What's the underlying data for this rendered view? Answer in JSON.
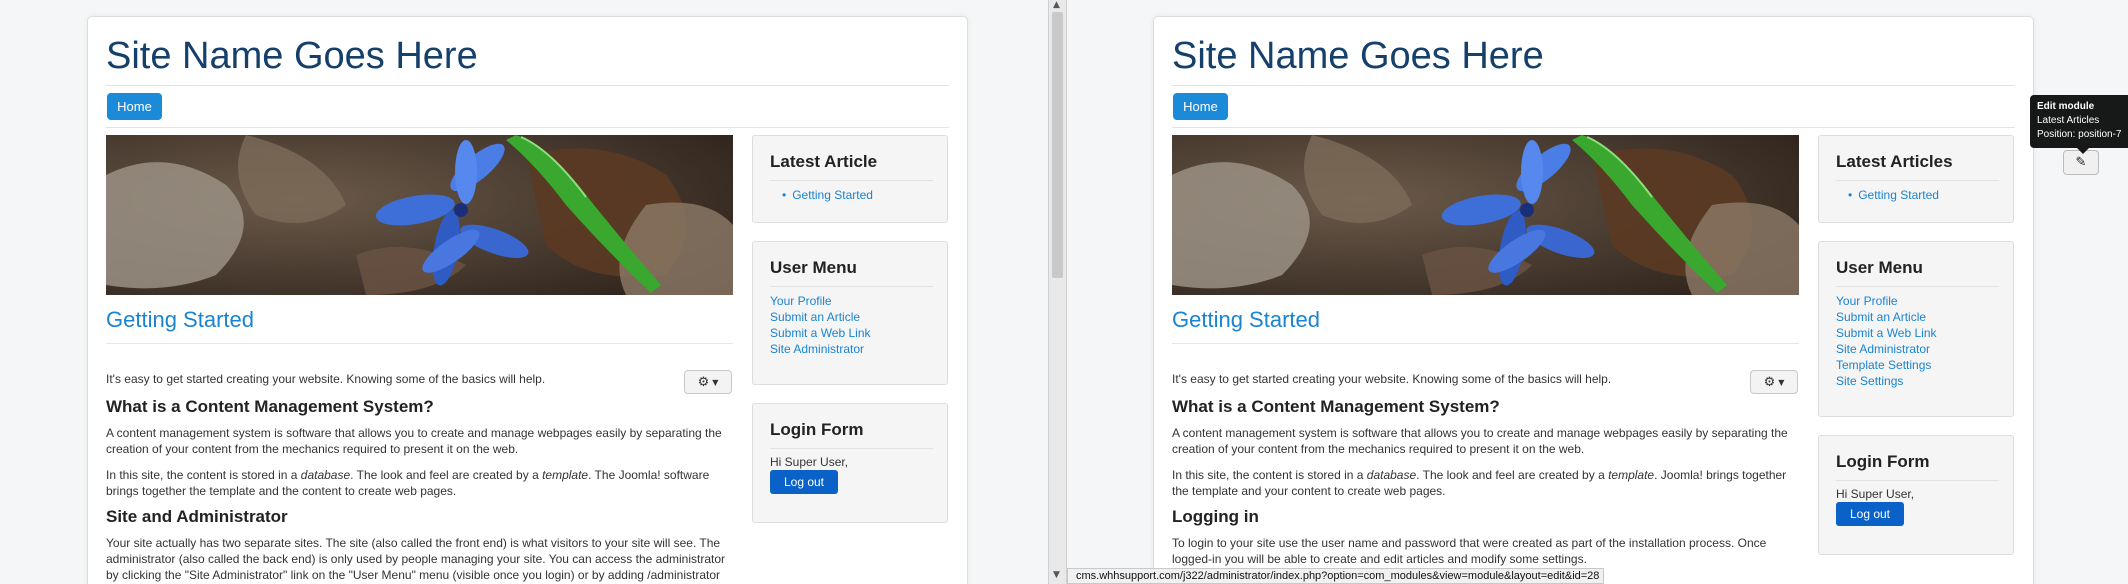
{
  "left": {
    "site_title": "Site Name Goes Here",
    "nav_home": "Home",
    "article_title": "Getting Started",
    "intro": "It's easy to get started creating your website. Knowing some of the basics will help.",
    "h_cms": "What is a Content Management System?",
    "p_cms": "A content management system is software that allows you to create and manage webpages easily by separating the creation of your content from the mechanics required to present it on the web.",
    "p_site_pre": "In this site, the content is stored in a ",
    "p_site_em1": "database",
    "p_site_mid": ". The look and feel are created by a ",
    "p_site_em2": "template",
    "p_site_post": ". The Joomla! software brings together the template and the content to create web pages.",
    "h_site_admin": "Site and Administrator",
    "p_site_admin": "Your site actually has two separate sites. The site (also called the front end) is what visitors to your site will see. The administrator (also called the back end) is only used by people managing your site. You can access the administrator by clicking the \"Site Administrator\" link on the \"User Menu\" menu (visible once you login) or by adding /administrator to the end of your domain name.",
    "module_latest_title": "Latest Article",
    "latest_items": [
      "Getting Started"
    ],
    "module_user_title": "User Menu",
    "user_items": [
      "Your Profile",
      "Submit an Article",
      "Submit a Web Link",
      "Site Administrator"
    ],
    "module_login_title": "Login Form",
    "greeting": "Hi Super User,",
    "logout": "Log out"
  },
  "right": {
    "site_title": "Site Name Goes Here",
    "nav_home": "Home",
    "article_title": "Getting Started",
    "intro": "It's easy to get started creating your website. Knowing some of the basics will help.",
    "h_cms": "What is a Content Management System?",
    "p_cms": "A content management system is software that allows you to create and manage webpages easily by separating the creation of your content from the mechanics required to present it on the web.",
    "p_site_pre": "In this site, the content is stored in a ",
    "p_site_em1": "database",
    "p_site_mid": ". The look and feel are created by a ",
    "p_site_em2": "template",
    "p_site_post": ". Joomla! brings together the template and your content to create web pages.",
    "h_logging": "Logging in",
    "p_logging": "To login to your site use the user name and password that were created as part of the installation process. Once logged-in you will be able to create and edit articles and modify some settings.",
    "module_latest_title": "Latest Articles",
    "latest_items": [
      "Getting Started"
    ],
    "module_user_title": "User Menu",
    "user_items": [
      "Your Profile",
      "Submit an Article",
      "Submit a Web Link",
      "Site Administrator",
      "Template Settings",
      "Site Settings"
    ],
    "module_login_title": "Login Form",
    "greeting": "Hi Super User,",
    "logout": "Log out",
    "tooltip": {
      "title": "Edit module",
      "line1": "Latest Articles",
      "line2": "Position: position-7"
    },
    "status_url": "cms.whhsupport.com/j322/administrator/index.php?option=com_modules&view=module&layout=edit&id=28"
  },
  "icons": {
    "gear": "gear-icon",
    "caret": "caret-down-icon",
    "edit": "edit-icon"
  },
  "colors": {
    "title": "#16406c",
    "link": "#1a84d1",
    "nav": "#1b8ad8",
    "logout": "#0a62c9"
  }
}
